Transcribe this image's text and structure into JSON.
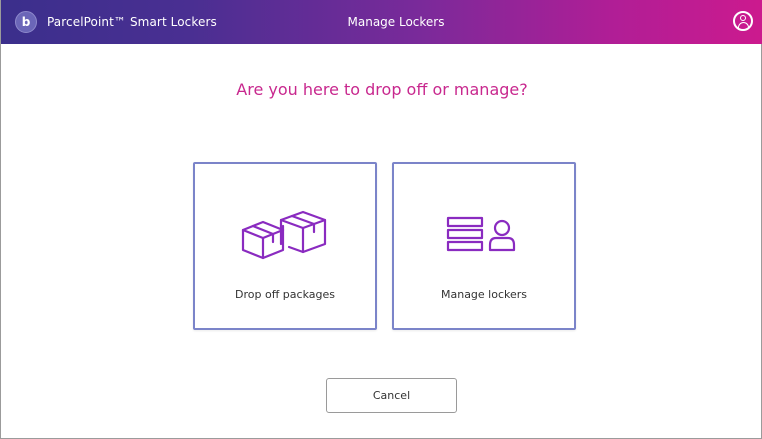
{
  "header": {
    "brand_logo_letter": "b",
    "brand_name": "ParcelPoint™ Smart Lockers",
    "title": "Manage Lockers",
    "user_icon": "user-circle-icon"
  },
  "main": {
    "question": "Are you here to drop off or manage?",
    "options": [
      {
        "label": "Drop off packages",
        "icon": "packages-icon"
      },
      {
        "label": "Manage lockers",
        "icon": "manage-lockers-icon"
      }
    ],
    "cancel_label": "Cancel"
  },
  "colors": {
    "accent": "#c8288e",
    "card_border": "#7b84c9",
    "icon_purple": "#8a2bc0",
    "header_start": "#3b2f8c",
    "header_end": "#cc1a8e"
  }
}
